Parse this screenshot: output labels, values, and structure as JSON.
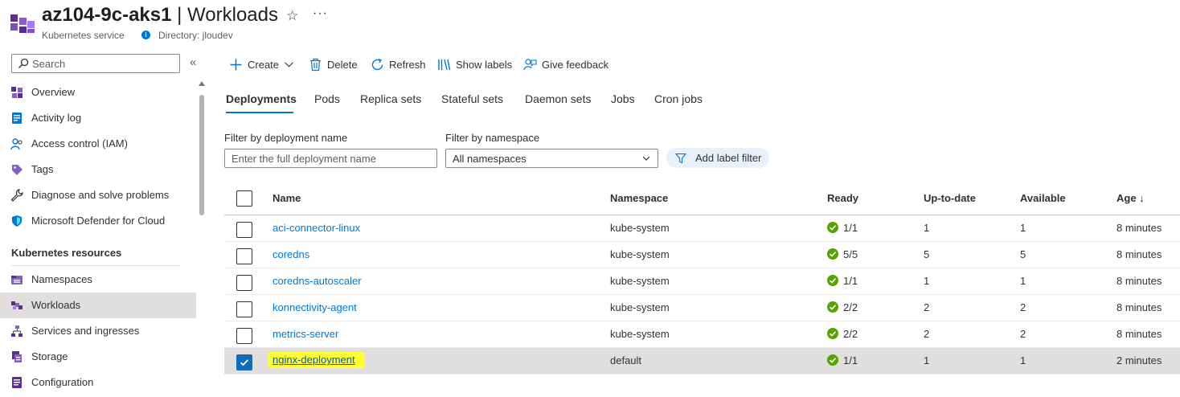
{
  "header": {
    "resource_name": "az104-9c-aks1",
    "separator": "|",
    "blade_title": "Workloads",
    "subtitle": "Kubernetes service",
    "directory": "Directory: jloudev",
    "star": "☆",
    "more": "···"
  },
  "sidebar": {
    "search_placeholder": "Search",
    "collapse": "«",
    "items": [
      {
        "label": "Overview",
        "icon": "overview-icon"
      },
      {
        "label": "Activity log",
        "icon": "activity-log-icon"
      },
      {
        "label": "Access control (IAM)",
        "icon": "iam-icon"
      },
      {
        "label": "Tags",
        "icon": "tag-icon"
      },
      {
        "label": "Diagnose and solve problems",
        "icon": "wrench-icon"
      },
      {
        "label": "Microsoft Defender for Cloud",
        "icon": "shield-icon"
      }
    ],
    "section_title": "Kubernetes resources",
    "resource_items": [
      {
        "label": "Namespaces",
        "icon": "namespaces-icon"
      },
      {
        "label": "Workloads",
        "icon": "workloads-icon",
        "active": true
      },
      {
        "label": "Services and ingresses",
        "icon": "services-icon"
      },
      {
        "label": "Storage",
        "icon": "storage-icon"
      },
      {
        "label": "Configuration",
        "icon": "configuration-icon"
      }
    ]
  },
  "toolbar": {
    "create": "Create",
    "delete": "Delete",
    "refresh": "Refresh",
    "show_labels": "Show labels",
    "give_feedback": "Give feedback"
  },
  "tabs": [
    "Deployments",
    "Pods",
    "Replica sets",
    "Stateful sets",
    "Daemon sets",
    "Jobs",
    "Cron jobs"
  ],
  "active_tab": "Deployments",
  "filters": {
    "name_label": "Filter by deployment name",
    "name_placeholder": "Enter the full deployment name",
    "namespace_label": "Filter by namespace",
    "namespace_value": "All namespaces",
    "add_label_filter": "Add label filter"
  },
  "table": {
    "columns": [
      "Name",
      "Namespace",
      "Ready",
      "Up-to-date",
      "Available",
      "Age ↓"
    ],
    "rows": [
      {
        "name": "aci-connector-linux",
        "namespace": "kube-system",
        "ready": "1/1",
        "up_to_date": "1",
        "available": "1",
        "age": "8 minutes",
        "selected": false
      },
      {
        "name": "coredns",
        "namespace": "kube-system",
        "ready": "5/5",
        "up_to_date": "5",
        "available": "5",
        "age": "8 minutes",
        "selected": false
      },
      {
        "name": "coredns-autoscaler",
        "namespace": "kube-system",
        "ready": "1/1",
        "up_to_date": "1",
        "available": "1",
        "age": "8 minutes",
        "selected": false
      },
      {
        "name": "konnectivity-agent",
        "namespace": "kube-system",
        "ready": "2/2",
        "up_to_date": "2",
        "available": "2",
        "age": "8 minutes",
        "selected": false
      },
      {
        "name": "metrics-server",
        "namespace": "kube-system",
        "ready": "2/2",
        "up_to_date": "2",
        "available": "2",
        "age": "8 minutes",
        "selected": false
      },
      {
        "name": "nginx-deployment",
        "namespace": "default",
        "ready": "1/1",
        "up_to_date": "1",
        "available": "1",
        "age": "2 minutes",
        "selected": true
      }
    ]
  },
  "colors": {
    "accent": "#0078d4",
    "success": "#57a300",
    "highlight": "#ffff33",
    "selected_row": "#e1dfdd"
  }
}
